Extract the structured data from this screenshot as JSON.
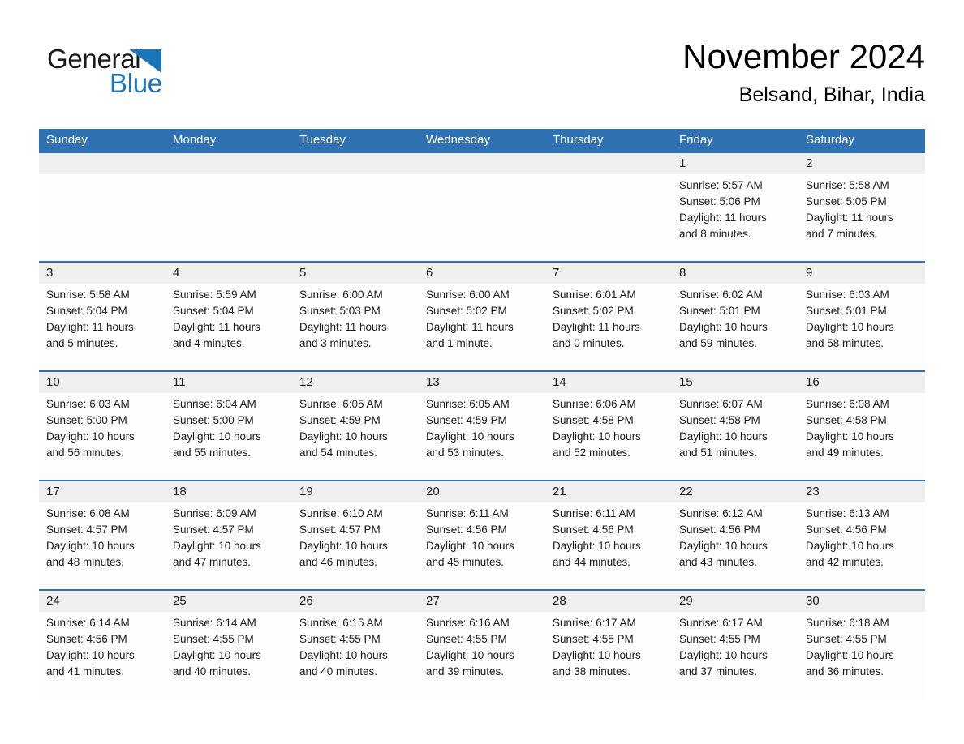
{
  "brand": {
    "name_part1": "General",
    "name_part2": "Blue",
    "triangle_icon": "triangle-logo-icon",
    "accent_color": "#1b76bc"
  },
  "header": {
    "month_title": "November 2024",
    "location": "Belsand, Bihar, India"
  },
  "theme": {
    "header_blue": "#2f72b3",
    "date_band_gray": "#efefef",
    "cell_white": "#fdfdfd",
    "text_black": "#1a1a1a"
  },
  "calendar": {
    "day_headers": [
      "Sunday",
      "Monday",
      "Tuesday",
      "Wednesday",
      "Thursday",
      "Friday",
      "Saturday"
    ],
    "weeks": [
      [
        {
          "day": "",
          "info": ""
        },
        {
          "day": "",
          "info": ""
        },
        {
          "day": "",
          "info": ""
        },
        {
          "day": "",
          "info": ""
        },
        {
          "day": "",
          "info": ""
        },
        {
          "day": "1",
          "info": "Sunrise: 5:57 AM\nSunset: 5:06 PM\nDaylight: 11 hours\nand 8 minutes."
        },
        {
          "day": "2",
          "info": "Sunrise: 5:58 AM\nSunset: 5:05 PM\nDaylight: 11 hours\nand 7 minutes."
        }
      ],
      [
        {
          "day": "3",
          "info": "Sunrise: 5:58 AM\nSunset: 5:04 PM\nDaylight: 11 hours\nand 5 minutes."
        },
        {
          "day": "4",
          "info": "Sunrise: 5:59 AM\nSunset: 5:04 PM\nDaylight: 11 hours\nand 4 minutes."
        },
        {
          "day": "5",
          "info": "Sunrise: 6:00 AM\nSunset: 5:03 PM\nDaylight: 11 hours\nand 3 minutes."
        },
        {
          "day": "6",
          "info": "Sunrise: 6:00 AM\nSunset: 5:02 PM\nDaylight: 11 hours\nand 1 minute."
        },
        {
          "day": "7",
          "info": "Sunrise: 6:01 AM\nSunset: 5:02 PM\nDaylight: 11 hours\nand 0 minutes."
        },
        {
          "day": "8",
          "info": "Sunrise: 6:02 AM\nSunset: 5:01 PM\nDaylight: 10 hours\nand 59 minutes."
        },
        {
          "day": "9",
          "info": "Sunrise: 6:03 AM\nSunset: 5:01 PM\nDaylight: 10 hours\nand 58 minutes."
        }
      ],
      [
        {
          "day": "10",
          "info": "Sunrise: 6:03 AM\nSunset: 5:00 PM\nDaylight: 10 hours\nand 56 minutes."
        },
        {
          "day": "11",
          "info": "Sunrise: 6:04 AM\nSunset: 5:00 PM\nDaylight: 10 hours\nand 55 minutes."
        },
        {
          "day": "12",
          "info": "Sunrise: 6:05 AM\nSunset: 4:59 PM\nDaylight: 10 hours\nand 54 minutes."
        },
        {
          "day": "13",
          "info": "Sunrise: 6:05 AM\nSunset: 4:59 PM\nDaylight: 10 hours\nand 53 minutes."
        },
        {
          "day": "14",
          "info": "Sunrise: 6:06 AM\nSunset: 4:58 PM\nDaylight: 10 hours\nand 52 minutes."
        },
        {
          "day": "15",
          "info": "Sunrise: 6:07 AM\nSunset: 4:58 PM\nDaylight: 10 hours\nand 51 minutes."
        },
        {
          "day": "16",
          "info": "Sunrise: 6:08 AM\nSunset: 4:58 PM\nDaylight: 10 hours\nand 49 minutes."
        }
      ],
      [
        {
          "day": "17",
          "info": "Sunrise: 6:08 AM\nSunset: 4:57 PM\nDaylight: 10 hours\nand 48 minutes."
        },
        {
          "day": "18",
          "info": "Sunrise: 6:09 AM\nSunset: 4:57 PM\nDaylight: 10 hours\nand 47 minutes."
        },
        {
          "day": "19",
          "info": "Sunrise: 6:10 AM\nSunset: 4:57 PM\nDaylight: 10 hours\nand 46 minutes."
        },
        {
          "day": "20",
          "info": "Sunrise: 6:11 AM\nSunset: 4:56 PM\nDaylight: 10 hours\nand 45 minutes."
        },
        {
          "day": "21",
          "info": "Sunrise: 6:11 AM\nSunset: 4:56 PM\nDaylight: 10 hours\nand 44 minutes."
        },
        {
          "day": "22",
          "info": "Sunrise: 6:12 AM\nSunset: 4:56 PM\nDaylight: 10 hours\nand 43 minutes."
        },
        {
          "day": "23",
          "info": "Sunrise: 6:13 AM\nSunset: 4:56 PM\nDaylight: 10 hours\nand 42 minutes."
        }
      ],
      [
        {
          "day": "24",
          "info": "Sunrise: 6:14 AM\nSunset: 4:56 PM\nDaylight: 10 hours\nand 41 minutes."
        },
        {
          "day": "25",
          "info": "Sunrise: 6:14 AM\nSunset: 4:55 PM\nDaylight: 10 hours\nand 40 minutes."
        },
        {
          "day": "26",
          "info": "Sunrise: 6:15 AM\nSunset: 4:55 PM\nDaylight: 10 hours\nand 40 minutes."
        },
        {
          "day": "27",
          "info": "Sunrise: 6:16 AM\nSunset: 4:55 PM\nDaylight: 10 hours\nand 39 minutes."
        },
        {
          "day": "28",
          "info": "Sunrise: 6:17 AM\nSunset: 4:55 PM\nDaylight: 10 hours\nand 38 minutes."
        },
        {
          "day": "29",
          "info": "Sunrise: 6:17 AM\nSunset: 4:55 PM\nDaylight: 10 hours\nand 37 minutes."
        },
        {
          "day": "30",
          "info": "Sunrise: 6:18 AM\nSunset: 4:55 PM\nDaylight: 10 hours\nand 36 minutes."
        }
      ]
    ]
  }
}
